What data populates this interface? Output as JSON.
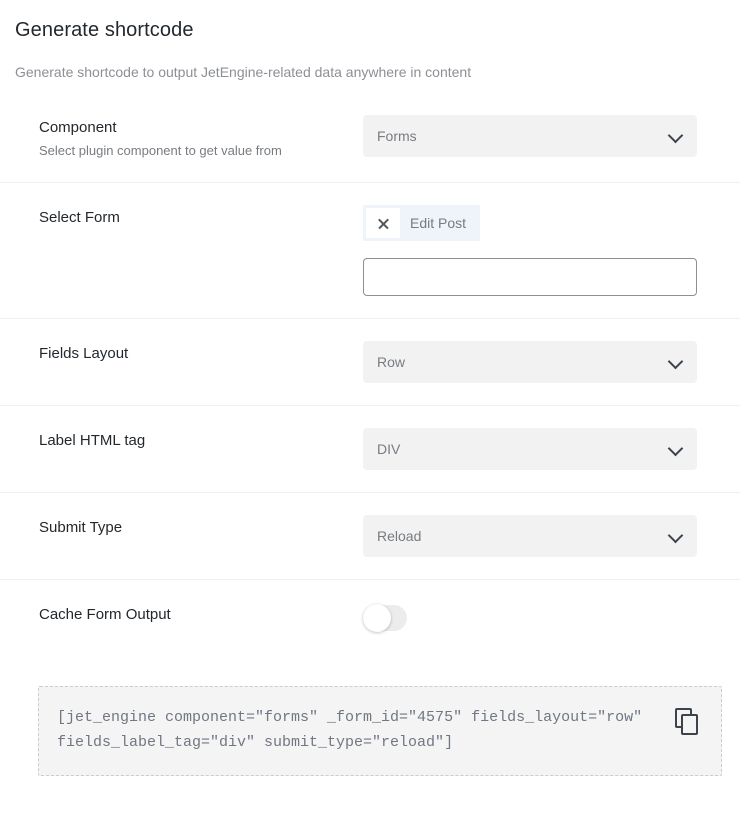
{
  "header": {
    "title": "Generate shortcode",
    "subtitle": "Generate shortcode to output JetEngine-related data anywhere in content"
  },
  "rows": {
    "component": {
      "label": "Component",
      "description": "Select plugin component to get value from",
      "value": "Forms"
    },
    "select_form": {
      "label": "Select Form",
      "chip_label": "Edit Post",
      "input_value": "",
      "input_placeholder": ""
    },
    "fields_layout": {
      "label": "Fields Layout",
      "value": "Row"
    },
    "label_html_tag": {
      "label": "Label HTML tag",
      "value": "DIV"
    },
    "submit_type": {
      "label": "Submit Type",
      "value": "Reload"
    },
    "cache_form_output": {
      "label": "Cache Form Output",
      "state": "off"
    }
  },
  "shortcode": {
    "text": "[jet_engine component=\"forms\" _form_id=\"4575\" fields_layout=\"row\" fields_label_tag=\"div\" submit_type=\"reload\"]"
  },
  "colors": {
    "title": "#23282d",
    "muted": "#8c8f94",
    "select_bg": "#f2f2f2",
    "chip_bg": "#eef4fa",
    "code_bg": "#f4f4f4",
    "divider": "#f0f0f1"
  },
  "icons": {
    "chevron": "chevron-down-icon",
    "remove": "close-icon",
    "copy": "copy-icon"
  }
}
